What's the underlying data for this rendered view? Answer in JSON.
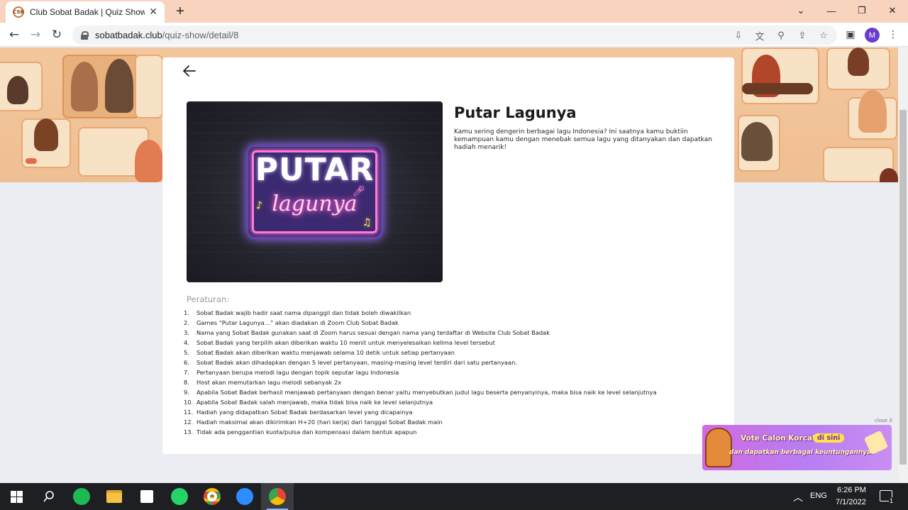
{
  "browser": {
    "tab_title": "Club Sobat Badak | Quiz Show",
    "url_host": "sobatbadak.club",
    "url_path": "/quiz-show/detail/8",
    "profile_initial": "M"
  },
  "quiz": {
    "title": "Putar Lagunya",
    "description": "Kamu sering dengerin berbagai lagu Indonesia? Ini saatnya kamu buktiin kemampuan kamu dengan menebak semua lagu yang ditanyakan dan dapatkan hadiah menarik!",
    "banner_text_1": "PUTAR",
    "banner_text_2": "lagunya",
    "rules_heading": "Peraturan:",
    "rules": [
      {
        "num": "1.",
        "text": "Sobat Badak wajib hadir saat nama dipanggil dan tidak boleh diwakilkan"
      },
      {
        "num": "2.",
        "text": "Games “Putar Lagunya…” akan diadakan di Zoom Club Sobat Badak"
      },
      {
        "num": "3.",
        "text": "Nama yang Sobat Badak gunakan saat di Zoom harus sesuai dengan nama yang terdaftar di Website Club Sobat Badak"
      },
      {
        "num": "4.",
        "text": "Sobat Badak yang terpilih akan diberikan waktu 10 menit untuk menyelesaikan kelima level tersebut"
      },
      {
        "num": "5.",
        "text": "Sobat Badak akan diberikan waktu menjawab selama 10 detik untuk setiap pertanyaan"
      },
      {
        "num": "6.",
        "text": "Sobat Badak akan dihadapkan dengan 5 level pertanyaan, masing-masing level terdiri dari satu pertanyaan."
      },
      {
        "num": "7.",
        "text": "Pertanyaan berupa melodi lagu dengan topik seputar lagu Indonesia"
      },
      {
        "num": "8.",
        "text": "Host akan memutarkan lagu melodi sebanyak 2x"
      },
      {
        "num": "9.",
        "text": "Apabila Sobat Badak berhasil menjawab pertanyaan dengan benar yaitu menyebutkan judul lagu beserta penyanyinya, maka bisa naik ke level selanjutnya"
      },
      {
        "num": "10.",
        "text": "Apabila Sobat Badak salah menjawab, maka tidak bisa naik ke level selanjutnya"
      },
      {
        "num": "11.",
        "text": "Hadiah yang didapatkan Sobat Badak berdasarkan level yang dicapainya"
      },
      {
        "num": "12.",
        "text": "Hadiah maksimal akan dikirimkan H+20 (hari kerja) dari tanggal Sobat Badak main"
      },
      {
        "num": "13.",
        "text": "Tidak ada penggantian kuota/pulsa dan kompensasi dalam bentuk apapun"
      }
    ]
  },
  "promo": {
    "close_label": "close X",
    "line1": "Vote Calon Korcab",
    "pill": "di sini",
    "line2": "dan dapatkan berbagai keuntungannya!"
  },
  "taskbar": {
    "language": "ENG",
    "time": "6:26 PM",
    "date": "7/1/2022",
    "notification_count": "1"
  },
  "colors": {
    "titlebar": "#f8d3be",
    "hero": "#f3c79d",
    "brand_purple": "#6a3dcc",
    "promo_purple": "#c27ae8"
  }
}
